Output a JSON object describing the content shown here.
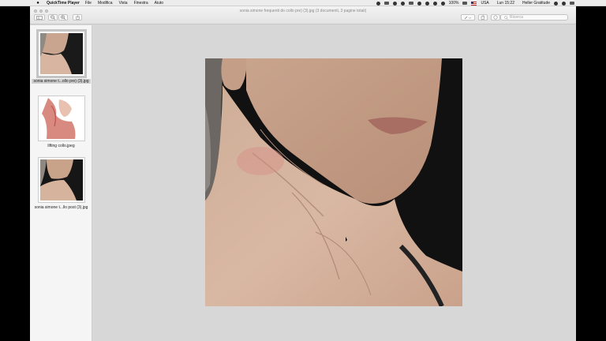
{
  "menubar": {
    "app_name": "QuickTime Player",
    "menus": [
      "File",
      "Modifica",
      "Vista",
      "Finestra",
      "Aiuto"
    ],
    "battery": "100%",
    "input_source": "USA",
    "clock": "Lun 15:22",
    "user": "Heller Gratitude"
  },
  "window": {
    "title": "sonia simone  frequenti do collo pre) (3).jpg (3 documenti, 3 pagine totali)",
    "search_placeholder": "Ricerca"
  },
  "sidebar": {
    "items": [
      {
        "caption": "sonia simone  t...ollo pre) (3).jpg",
        "selected": true
      },
      {
        "caption": "lifting collo.jpeg",
        "selected": false
      },
      {
        "caption": "sonia simone  t...llo post (3).jpg",
        "selected": false
      }
    ]
  }
}
